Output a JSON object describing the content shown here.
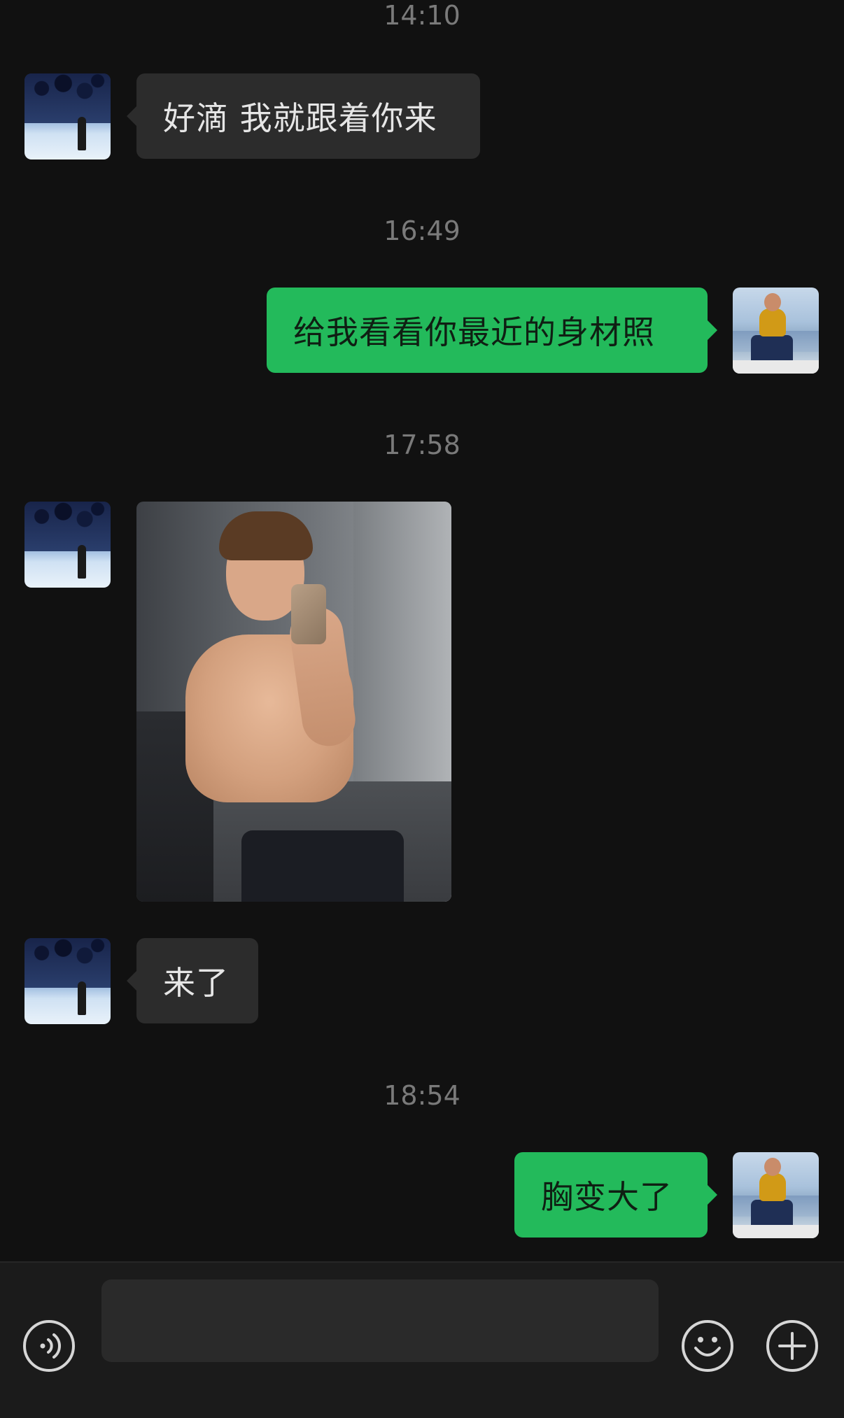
{
  "chat": {
    "timestamps": [
      "14:10",
      "16:49",
      "17:58",
      "18:54"
    ],
    "messages": [
      {
        "sender": "contact",
        "type": "text",
        "text": "好滴 我就跟着你来"
      },
      {
        "sender": "me",
        "type": "text",
        "text": "给我看看你最近的身材照"
      },
      {
        "sender": "contact",
        "type": "image"
      },
      {
        "sender": "contact",
        "type": "text",
        "text": "来了"
      },
      {
        "sender": "me",
        "type": "text",
        "text": "胸变大了"
      }
    ]
  },
  "input_bar": {
    "placeholder": "",
    "icons": [
      "voice-icon",
      "emoji-icon",
      "plus-icon"
    ]
  },
  "colors": {
    "background": "#111111",
    "incoming_bubble": "#2c2c2c",
    "outgoing_bubble": "#23ba5b",
    "timestamp": "#7a7a7a"
  }
}
